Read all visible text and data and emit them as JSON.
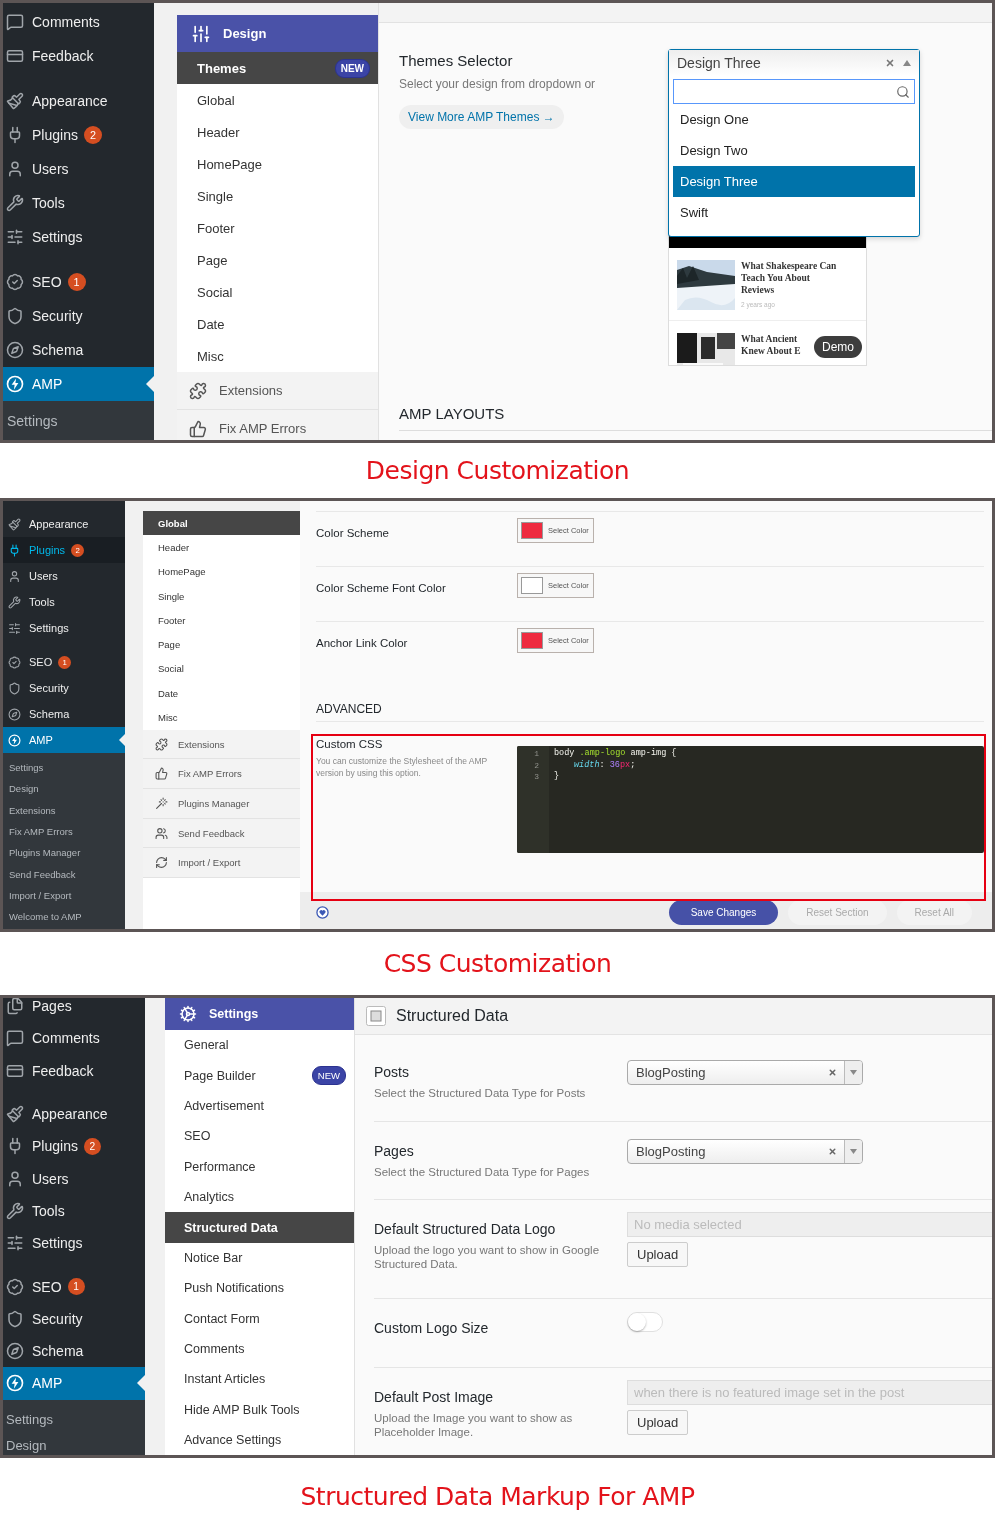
{
  "design_panel": {
    "wp_menu": {
      "groups": [
        [
          {
            "kind": "comments",
            "label": "Comments",
            "selected": false
          },
          {
            "kind": "feedback",
            "label": "Feedback",
            "selected": false
          }
        ],
        [
          {
            "kind": "appearance",
            "label": "Appearance",
            "selected": false
          },
          {
            "kind": "plugins",
            "label": "Plugins",
            "badge": "2",
            "selected": false
          },
          {
            "kind": "users",
            "label": "Users",
            "selected": false
          },
          {
            "kind": "tools",
            "label": "Tools",
            "selected": false
          },
          {
            "kind": "settings",
            "label": "Settings",
            "selected": false
          }
        ],
        [
          {
            "kind": "seo",
            "label": "SEO",
            "badge": "1",
            "selected": false
          },
          {
            "kind": "security",
            "label": "Security",
            "selected": false
          },
          {
            "kind": "schema",
            "label": "Schema",
            "selected": false
          },
          {
            "kind": "amp",
            "label": "AMP",
            "selected": true
          }
        ]
      ],
      "submenu": [
        "Settings"
      ]
    },
    "subnav": {
      "title": "Design",
      "items": [
        {
          "label": "Themes",
          "badge": "NEW",
          "selected": true
        },
        {
          "label": "Global",
          "selected": false
        },
        {
          "label": "Header",
          "selected": false
        },
        {
          "label": "HomePage",
          "selected": false
        },
        {
          "label": "Single",
          "selected": false
        },
        {
          "label": "Footer",
          "selected": false
        },
        {
          "label": "Page",
          "selected": false
        },
        {
          "label": "Social",
          "selected": false
        },
        {
          "label": "Date",
          "selected": false
        },
        {
          "label": "Misc",
          "selected": false
        }
      ],
      "tools": [
        {
          "kind": "extensions",
          "label": "Extensions"
        },
        {
          "kind": "fix",
          "label": "Fix AMP Errors"
        }
      ]
    },
    "themes_selector": {
      "title": "Themes Selector",
      "description": "Select your design from dropdown or",
      "link": "View More AMP Themes →",
      "select": {
        "value": "Design Three",
        "expanded": true,
        "options": [
          {
            "label": "Design One",
            "selected": false
          },
          {
            "label": "Design Two",
            "selected": false
          },
          {
            "label": "Design Three",
            "selected": true
          },
          {
            "label": "Swift",
            "selected": false
          }
        ]
      }
    },
    "preview": {
      "articles": [
        {
          "title_lines": [
            "What Shakespeare Can",
            "Teach You About",
            "Reviews"
          ],
          "meta": "2 years ago"
        },
        {
          "title_lines": [
            "What Ancient",
            "Knew About E"
          ]
        }
      ],
      "demo_button": "Demo"
    },
    "section_heading": "AMP LAYOUTS",
    "caption": "Design Customization"
  },
  "css_panel": {
    "wp_menu": {
      "groups": [
        [
          {
            "kind": "appearance",
            "label": "Appearance",
            "selected": false,
            "hovered": false
          },
          {
            "kind": "plugins",
            "label": "Plugins",
            "badge": "2",
            "selected": false,
            "hovered": true
          },
          {
            "kind": "users",
            "label": "Users",
            "selected": false,
            "hovered": false
          },
          {
            "kind": "tools",
            "label": "Tools",
            "selected": false,
            "hovered": false
          },
          {
            "kind": "settings",
            "label": "Settings",
            "selected": false,
            "hovered": false
          }
        ],
        [
          {
            "kind": "seo",
            "label": "SEO",
            "badge": "1",
            "selected": false,
            "hovered": false
          },
          {
            "kind": "security",
            "label": "Security",
            "selected": false,
            "hovered": false
          },
          {
            "kind": "schema",
            "label": "Schema",
            "selected": false,
            "hovered": false
          },
          {
            "kind": "amp",
            "label": "AMP",
            "selected": true,
            "hovered": false
          }
        ]
      ],
      "submenu": [
        "Settings",
        "Design",
        "Extensions",
        "Fix AMP Errors",
        "Plugins Manager",
        "Send Feedback",
        "Import / Export",
        "Welcome to AMP"
      ]
    },
    "subnav": {
      "items": [
        {
          "label": "Global",
          "selected": true
        },
        {
          "label": "Header",
          "selected": false
        },
        {
          "label": "HomePage",
          "selected": false
        },
        {
          "label": "Single",
          "selected": false
        },
        {
          "label": "Footer",
          "selected": false
        },
        {
          "label": "Page",
          "selected": false
        },
        {
          "label": "Social",
          "selected": false
        },
        {
          "label": "Date",
          "selected": false
        },
        {
          "label": "Misc",
          "selected": false
        }
      ],
      "tools": [
        {
          "kind": "extensions",
          "label": "Extensions"
        },
        {
          "kind": "fix",
          "label": "Fix AMP Errors"
        },
        {
          "kind": "plugins-manager",
          "label": "Plugins Manager"
        },
        {
          "kind": "feedback",
          "label": "Send Feedback"
        },
        {
          "kind": "import",
          "label": "Import / Export"
        }
      ]
    },
    "color_rows": [
      {
        "label": "Color Scheme",
        "color": "#ee2a3f",
        "button": "Select Color"
      },
      {
        "label": "Color Scheme Font Color",
        "color": "#ffffff",
        "button": "Select Color"
      },
      {
        "label": "Anchor Link Color",
        "color": "#ee2a3f",
        "button": "Select Color"
      }
    ],
    "advanced_heading": "ADVANCED",
    "custom_css": {
      "title": "Custom CSS",
      "description": "You can customize the Stylesheet of the AMP version by using this option.",
      "highlighted": true,
      "lines": [
        {
          "number": "1",
          "indented": false,
          "tokens": [
            {
              "kind": "plain",
              "text": "body "
            },
            {
              "kind": "class",
              "text": ".amp-logo"
            },
            {
              "kind": "plain",
              "text": " amp-img {"
            }
          ]
        },
        {
          "number": "2",
          "indented": true,
          "tokens": [
            {
              "kind": "property",
              "text": "width"
            },
            {
              "kind": "plain",
              "text": ": "
            },
            {
              "kind": "number",
              "text": "36"
            },
            {
              "kind": "unit",
              "text": "px"
            },
            {
              "kind": "plain",
              "text": ";"
            }
          ]
        },
        {
          "number": "3",
          "indented": false,
          "tokens": [
            {
              "kind": "plain",
              "text": "}"
            }
          ]
        }
      ]
    },
    "footer": {
      "save": "Save Changes",
      "reset_section": "Reset Section",
      "reset_all": "Reset All"
    },
    "caption": "CSS Customization"
  },
  "structured_panel": {
    "wp_menu": {
      "groups": [
        [
          {
            "kind": "pages",
            "label": "Pages",
            "selected": false
          },
          {
            "kind": "comments",
            "label": "Comments",
            "selected": false
          },
          {
            "kind": "feedback",
            "label": "Feedback",
            "selected": false
          }
        ],
        [
          {
            "kind": "appearance",
            "label": "Appearance",
            "selected": false
          },
          {
            "kind": "plugins",
            "label": "Plugins",
            "badge": "2",
            "selected": false
          },
          {
            "kind": "users",
            "label": "Users",
            "selected": false
          },
          {
            "kind": "tools",
            "label": "Tools",
            "selected": false
          },
          {
            "kind": "settings",
            "label": "Settings",
            "selected": false
          }
        ],
        [
          {
            "kind": "seo",
            "label": "SEO",
            "badge": "1",
            "selected": false
          },
          {
            "kind": "security",
            "label": "Security",
            "selected": false
          },
          {
            "kind": "schema",
            "label": "Schema",
            "selected": false
          },
          {
            "kind": "amp",
            "label": "AMP",
            "selected": true
          }
        ]
      ],
      "submenu": [
        "Settings",
        "Design"
      ]
    },
    "subnav": {
      "title": "Settings",
      "items": [
        {
          "label": "General",
          "selected": false
        },
        {
          "label": "Page Builder",
          "badge": "NEW",
          "selected": false
        },
        {
          "label": "Advertisement",
          "selected": false
        },
        {
          "label": "SEO",
          "selected": false
        },
        {
          "label": "Performance",
          "selected": false
        },
        {
          "label": "Analytics",
          "selected": false
        },
        {
          "label": "Structured Data",
          "selected": true
        },
        {
          "label": "Notice Bar",
          "selected": false
        },
        {
          "label": "Push Notifications",
          "selected": false
        },
        {
          "label": "Contact Form",
          "selected": false
        },
        {
          "label": "Comments",
          "selected": false
        },
        {
          "label": "Instant Articles",
          "selected": false
        },
        {
          "label": "Hide AMP Bulk Tools",
          "selected": false
        },
        {
          "label": "Advance Settings",
          "selected": false
        }
      ]
    },
    "title": "Structured Data",
    "rows": [
      {
        "kind": "select",
        "label": "Posts",
        "description": "Select the Structured Data Type for Posts",
        "value": "BlogPosting"
      },
      {
        "kind": "select",
        "label": "Pages",
        "description": "Select the Structured Data Type for Pages",
        "value": "BlogPosting"
      },
      {
        "kind": "upload",
        "label": "Default Structured Data Logo",
        "description": "Upload the logo you want to show in Google Structured Data.",
        "placeholder": "No media selected",
        "button": "Upload"
      },
      {
        "kind": "toggle",
        "label": "Custom Logo Size",
        "on": false
      },
      {
        "kind": "upload",
        "label": "Default Post Image",
        "description": "Upload the Image you want to show as Placeholder Image.",
        "placeholder": "when there is no featured image set in the post",
        "button": "Upload"
      }
    ],
    "caption": "Structured Data Markup For AMP"
  }
}
